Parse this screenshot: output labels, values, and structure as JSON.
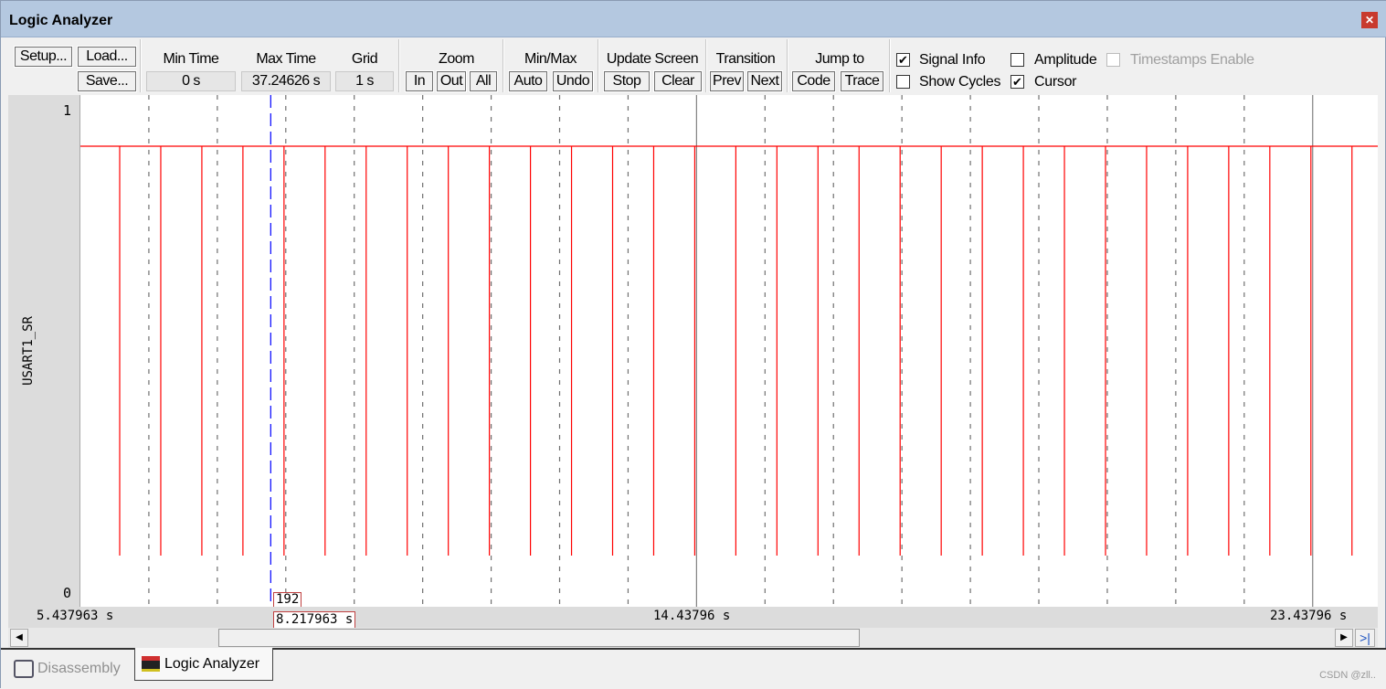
{
  "window": {
    "title": "Logic Analyzer",
    "close_icon": "close-icon"
  },
  "toolbar": {
    "setup": "Setup...",
    "load": "Load...",
    "save": "Save...",
    "min_time_label": "Min Time",
    "min_time": "0 s",
    "max_time_label": "Max Time",
    "max_time": "37.24626 s",
    "grid_label": "Grid",
    "grid": "1 s",
    "zoom_label": "Zoom",
    "zoom_in": "In",
    "zoom_out": "Out",
    "zoom_all": "All",
    "minmax_label": "Min/Max",
    "auto": "Auto",
    "undo": "Undo",
    "update_label": "Update Screen",
    "stop": "Stop",
    "clear": "Clear",
    "transition_label": "Transition",
    "prev": "Prev",
    "next": "Next",
    "jump_label": "Jump to",
    "code": "Code",
    "trace": "Trace",
    "signal_info": {
      "label": "Signal Info",
      "checked": true
    },
    "show_cycles": {
      "label": "Show Cycles",
      "checked": false
    },
    "amplitude": {
      "label": "Amplitude",
      "checked": false
    },
    "cursor": {
      "label": "Cursor",
      "checked": true
    },
    "timestamps": {
      "label": "Timestamps Enable",
      "checked": false,
      "disabled": true
    }
  },
  "signal": {
    "name": "USART1_SR",
    "high_label": "1",
    "low_label": "0",
    "color": "#ff0000"
  },
  "cursor": {
    "time": "8.217963 s",
    "value": "192",
    "color": "#0000ff"
  },
  "axis": {
    "left": "5.437963 s",
    "mid": "14.43796 s",
    "right": "23.43796 s",
    "start": 5.437963,
    "grid_s": 1
  },
  "pulses_s": [
    6.012,
    6.612,
    7.212,
    7.812,
    8.412,
    9.012,
    9.612,
    10.212,
    10.812,
    11.412,
    12.012,
    12.612,
    13.212,
    13.812,
    14.412,
    15.012,
    15.612,
    16.212,
    16.812,
    17.412,
    18.012,
    18.612,
    19.212,
    19.812,
    20.412,
    21.012,
    21.612,
    22.212,
    22.812,
    23.412,
    24.012
  ],
  "tabs": [
    {
      "label": "Disassembly",
      "active": false
    },
    {
      "label": "Logic Analyzer",
      "active": true
    }
  ],
  "watermark": "CSDN @zll.."
}
